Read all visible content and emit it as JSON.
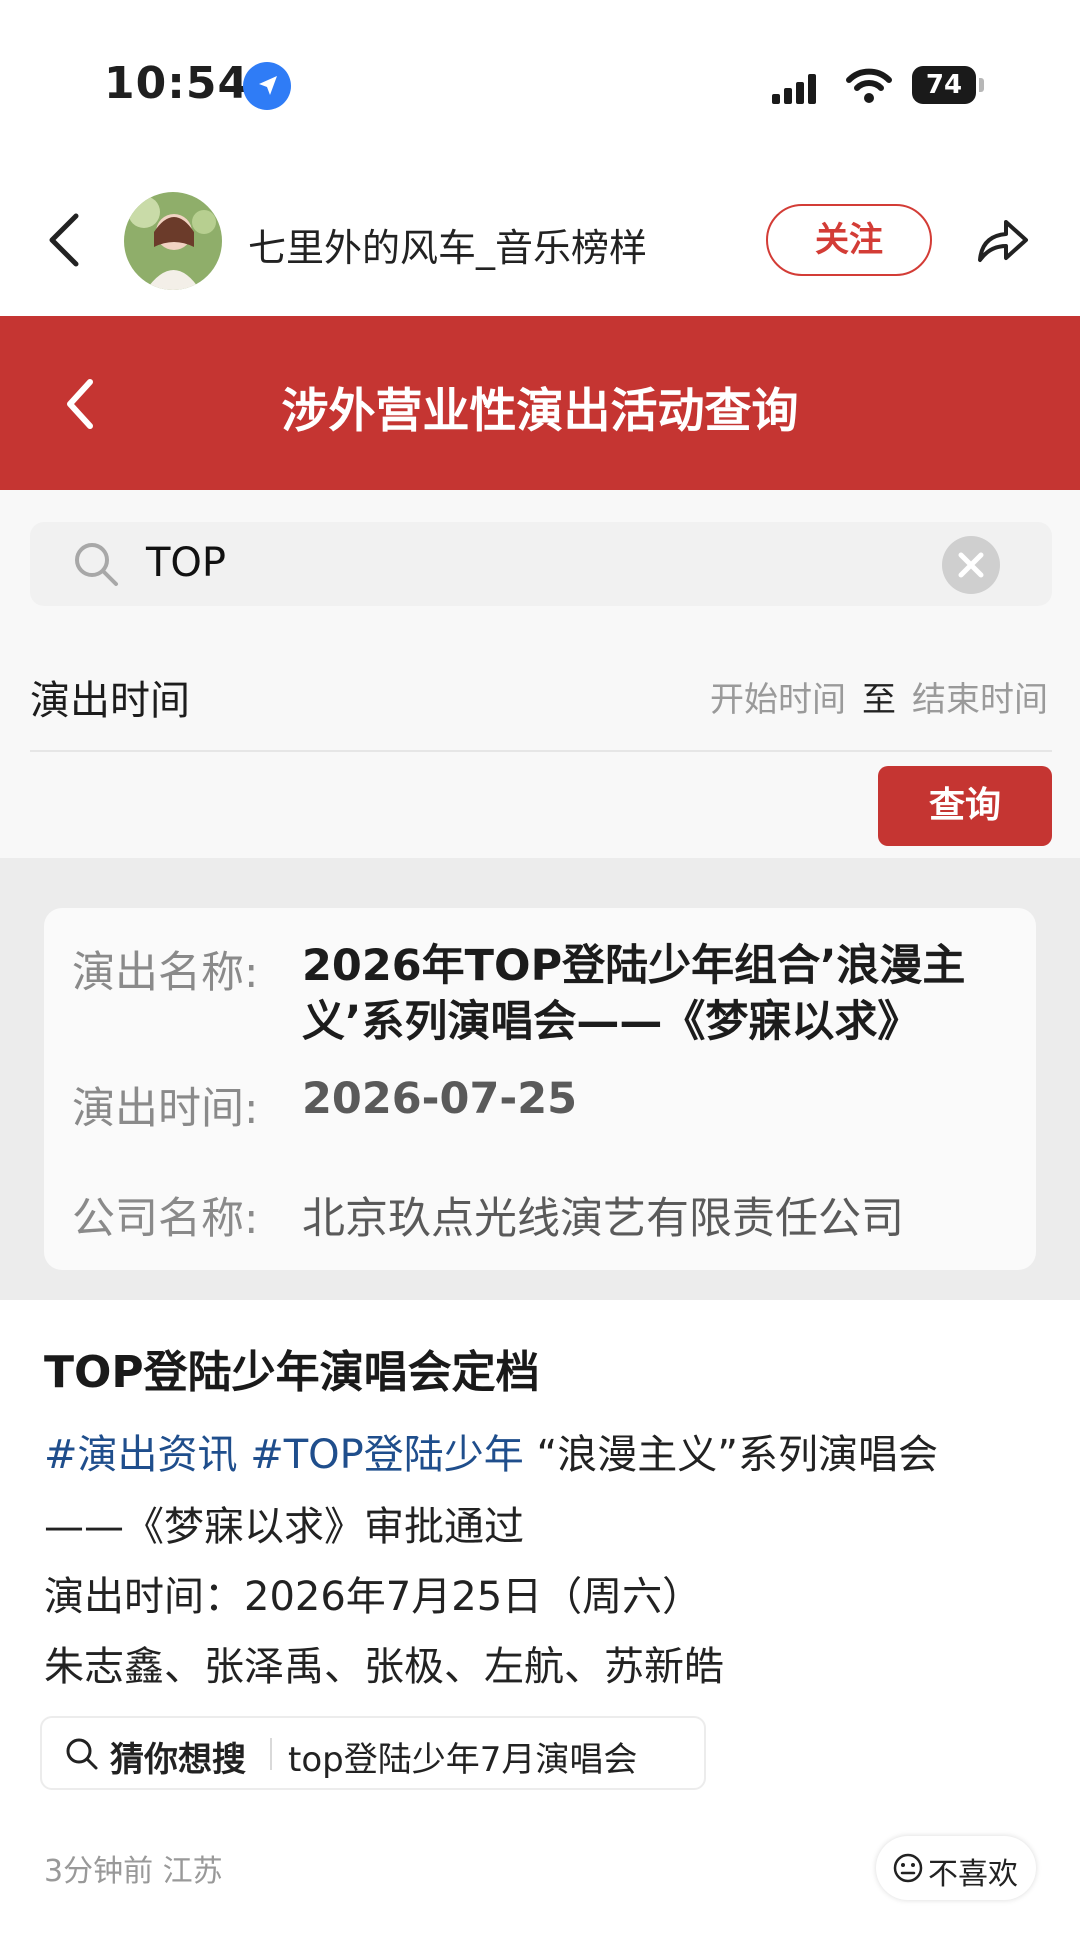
{
  "status_bar": {
    "time": "10:54",
    "battery": "74"
  },
  "header": {
    "author_name": "七里外的风车_音乐榜样",
    "follow_label": "关注"
  },
  "embedded": {
    "banner_title": "涉外营业性演出活动查询",
    "search_value": "TOP",
    "time_filter": {
      "label": "演出时间",
      "start_placeholder": "开始时间",
      "separator": "至",
      "end_placeholder": "结束时间"
    },
    "query_button": "查询",
    "result": {
      "name_label": "演出名称:",
      "name_value": "2026年TOP登陆少年组合’浪漫主义’系列演唱会——《梦寐以求》",
      "time_label": "演出时间:",
      "time_value": "2026-07-25",
      "company_label": "公司名称:",
      "company_value": "北京玖点光线演艺有限责任公司"
    }
  },
  "post": {
    "title": "TOP登陆少年演唱会定档",
    "hashtag1": "#演出资讯",
    "hashtag2": "#TOP登陆少年",
    "line1_text": " “浪漫主义”系列演唱会",
    "line2": "——《梦寐以求》审批通过",
    "line3": "演出时间：2026年7月25日（周六）",
    "line4": "朱志鑫、张泽禹、张极、左航、苏新皓",
    "guess_label": "猜你想搜",
    "guess_query": "top登陆少年7月演唱会",
    "meta": "3分钟前 江苏",
    "dislike_label": "不喜欢"
  },
  "colors": {
    "brand_red": "#c53532",
    "follow_red": "#d33c36",
    "hashtag_blue": "#1f4e8c",
    "location_blue": "#2f7cf6"
  },
  "icons": [
    "location-arrow-icon",
    "signal-icon",
    "wifi-icon",
    "battery-icon",
    "back-chevron-icon",
    "share-icon",
    "search-icon",
    "clear-icon",
    "smile-face-icon"
  ]
}
